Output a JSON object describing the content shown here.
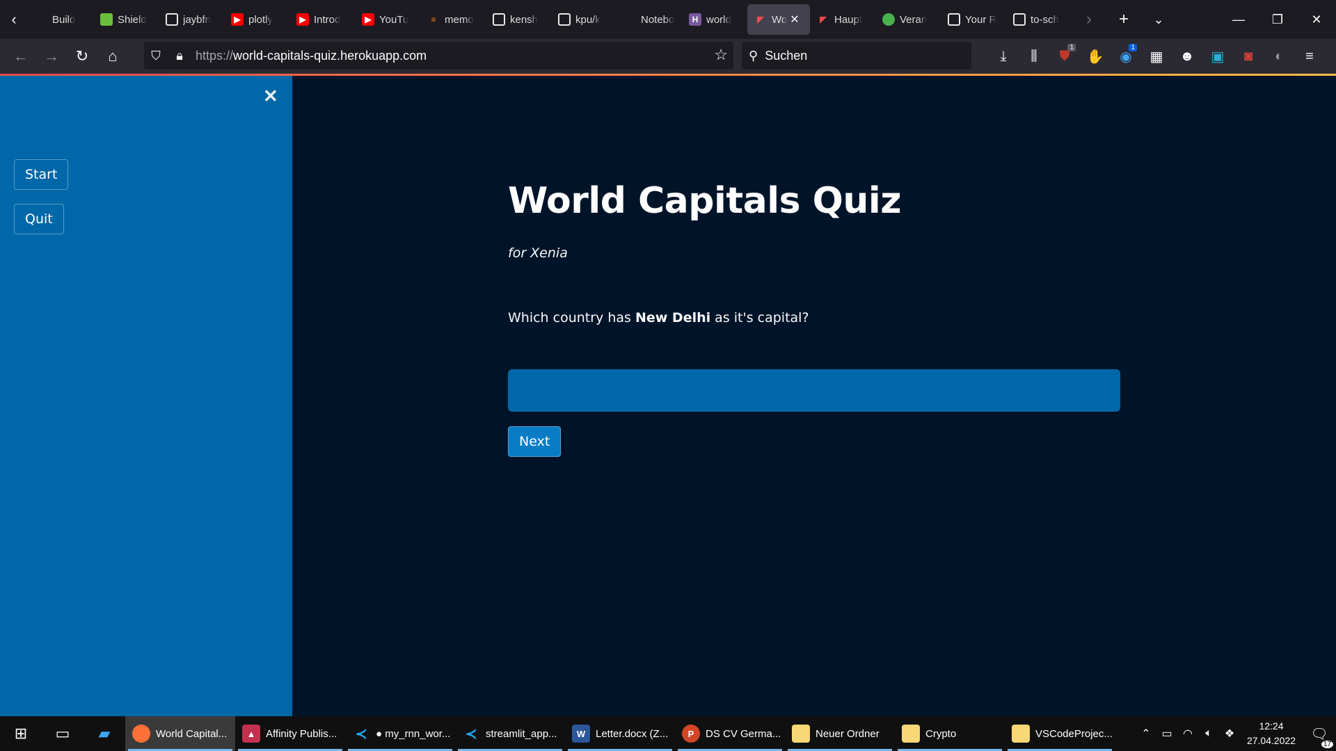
{
  "browser": {
    "tabs": [
      {
        "label": "Build",
        "icon": "blank-icon"
      },
      {
        "label": "Shield",
        "icon": "shield-favicon"
      },
      {
        "label": "jaybfn",
        "icon": "github-icon"
      },
      {
        "label": "plotly",
        "icon": "youtube-icon"
      },
      {
        "label": "Introd",
        "icon": "youtube-icon"
      },
      {
        "label": "YouTu",
        "icon": "youtube-icon"
      },
      {
        "label": "memo",
        "icon": "stackoverflow-icon"
      },
      {
        "label": "kensh",
        "icon": "github-icon"
      },
      {
        "label": "kpu/k",
        "icon": "github-icon"
      },
      {
        "label": "Notebook",
        "icon": "blank-icon"
      },
      {
        "label": "world",
        "icon": "heroku-icon"
      },
      {
        "label": "Wo",
        "icon": "streamlit-icon",
        "active": true
      },
      {
        "label": "Haupt",
        "icon": "streamlit-icon"
      },
      {
        "label": "Veran",
        "icon": "green-favicon"
      },
      {
        "label": "Your R",
        "icon": "github-icon"
      },
      {
        "label": "to-sch",
        "icon": "github-icon"
      }
    ],
    "url": {
      "protocol": "https://",
      "host": "world-capitals-quiz.herokuapp.com"
    },
    "search_placeholder": "Suchen",
    "badges": {
      "ublock": "1",
      "extension_blue": "1"
    }
  },
  "sidebar": {
    "buttons": {
      "start": "Start",
      "quit": "Quit"
    },
    "bg_color": "#0068a8"
  },
  "main": {
    "title": "World Capitals Quiz",
    "subtitle": "for Xenia",
    "question": {
      "prefix": "Which country has ",
      "capital": "New Delhi",
      "suffix": " as it's capital?"
    },
    "answer_value": "",
    "next_label": "Next",
    "bg_color": "#001429"
  },
  "taskbar": {
    "apps": [
      {
        "label": "World Capital...",
        "icon": "firefox-icon",
        "active": true
      },
      {
        "label": "Affinity Publis...",
        "icon": "affinity-icon"
      },
      {
        "label": "● my_rnn_wor...",
        "icon": "vscode-icon"
      },
      {
        "label": "streamlit_app...",
        "icon": "vscode-icon"
      },
      {
        "label": "Letter.docx (Z...",
        "icon": "word-icon"
      },
      {
        "label": "DS CV Germa...",
        "icon": "powerpoint-icon"
      },
      {
        "label": "Neuer Ordner",
        "icon": "folder-icon"
      },
      {
        "label": "Crypto",
        "icon": "folder-icon"
      },
      {
        "label": "VSCodeProjec...",
        "icon": "folder-icon"
      }
    ],
    "time": "12:24",
    "date": "27.04.2022",
    "notifications": "17"
  }
}
